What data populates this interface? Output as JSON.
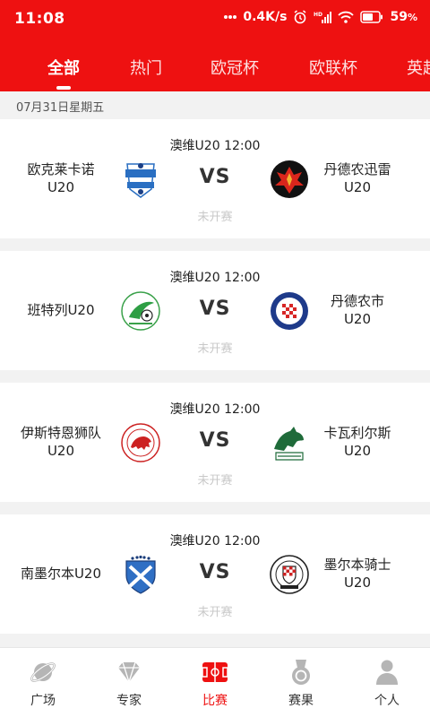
{
  "status_bar": {
    "time": "11:08",
    "network_speed": "0.4K/s",
    "battery": "59"
  },
  "tabs": [
    {
      "label": "全部",
      "active": true
    },
    {
      "label": "热门",
      "active": false
    },
    {
      "label": "欧冠杯",
      "active": false
    },
    {
      "label": "欧联杯",
      "active": false
    },
    {
      "label": "英超",
      "active": false
    }
  ],
  "date_header": "07月31日星期五",
  "matches": [
    {
      "league_time": "澳维U20 12:00",
      "home_line1": "欧克莱卡诺",
      "home_line2": "U20",
      "away_line1": "丹德农迅雷",
      "away_line2": "U20",
      "vs": "VS",
      "status": "未开赛",
      "home_logo_icon": "oakleigh-cannons-logo",
      "away_logo_icon": "dandenong-thunder-logo"
    },
    {
      "league_time": "澳维U20 12:00",
      "home_line1": "班特列U20",
      "home_line2": "",
      "away_line1": "丹德农市",
      "away_line2": "U20",
      "vs": "VS",
      "status": "未开赛",
      "home_logo_icon": "bentleigh-greens-logo",
      "away_logo_icon": "dandenong-city-logo"
    },
    {
      "league_time": "澳维U20 12:00",
      "home_line1": "伊斯特恩狮队",
      "home_line2": "U20",
      "away_line1": "卡瓦利尔斯",
      "away_line2": "U20",
      "vs": "VS",
      "status": "未开赛",
      "home_logo_icon": "eastern-lions-logo",
      "away_logo_icon": "caulfield-logo"
    },
    {
      "league_time": "澳维U20 12:00",
      "home_line1": "南墨尔本U20",
      "home_line2": "",
      "away_line1": "墨尔本骑士",
      "away_line2": "U20",
      "vs": "VS",
      "status": "未开赛",
      "home_logo_icon": "south-melbourne-logo",
      "away_logo_icon": "melbourne-knights-logo"
    }
  ],
  "bottom_nav": [
    {
      "label": "广场",
      "icon": "planet-icon",
      "active": false
    },
    {
      "label": "专家",
      "icon": "diamond-icon",
      "active": false
    },
    {
      "label": "比赛",
      "icon": "pitch-icon",
      "active": true
    },
    {
      "label": "赛果",
      "icon": "medal-icon",
      "active": false
    },
    {
      "label": "个人",
      "icon": "person-icon",
      "active": false
    }
  ],
  "colors": {
    "brand_red": "#ee1111",
    "pending_gray": "#c8c8c8",
    "nav_icon_gray": "#b5b5b5"
  }
}
